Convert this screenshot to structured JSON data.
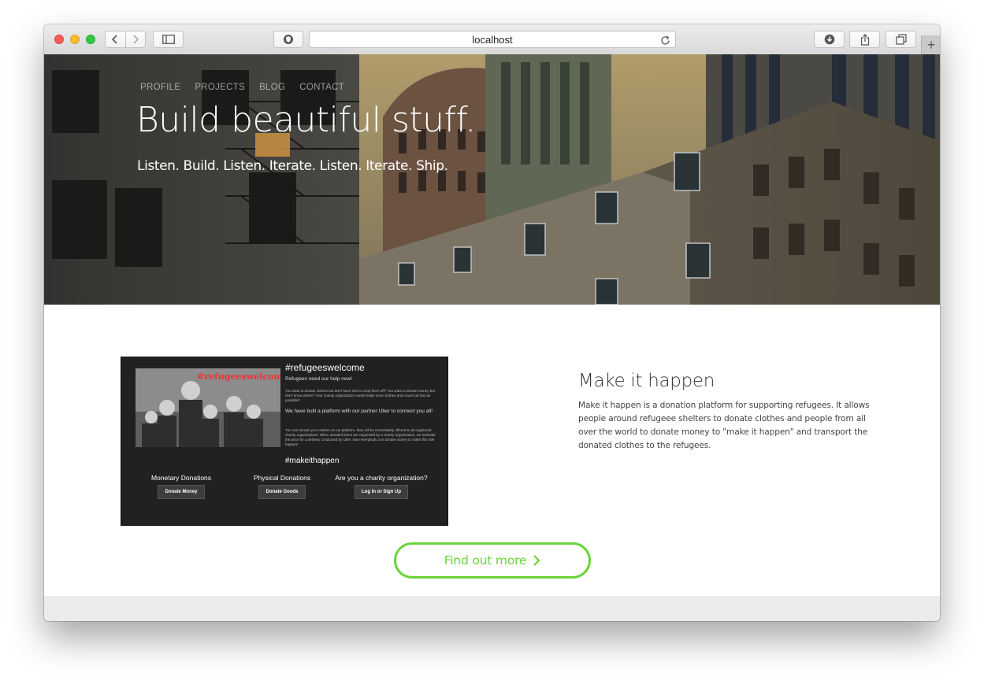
{
  "browser": {
    "url": "localhost",
    "new_tab": "+"
  },
  "nav": {
    "items": [
      "PROFILE",
      "PROJECTS",
      "BLOG",
      "CONTACT"
    ]
  },
  "hero": {
    "title": "Build beautiful stuff.",
    "subtitle": "Listen. Build. Listen. Iterate. Listen. Iterate. Ship."
  },
  "project": {
    "title": "Make it happen",
    "description": "Make it happen is a donation platform for supporting refugees. It allows people around refugeee shelters to donate clothes and people from all over the world to donate money to \"make it happen\" and transport the donated clothes to the refugees.",
    "cta_label": "Find out more"
  },
  "preview": {
    "photo_stamp": "#refugeeswelcome",
    "heading": "#refugeeswelcome",
    "tagline": "Refugees need our help now!",
    "para1": "You want to donate clothes but don't have time to drop them off? You want to donate money but don't know where? Your charity organization needs helps more clothes and covers as fast as possible?",
    "para2": "We have built a platform with our partner Uber to connect you all!",
    "para3": "You can donate your clothes on our platform, they will be immediately offered to all registered charity organizations. When donated items are requested by a charity organization, we estimate the price for a delivery conducted by Uber. Now everybody can donate money to make this ride happen!",
    "hashtag": "#makeithappen",
    "col1_label": "Monetary Donations",
    "col1_button": "Donate Money",
    "col2_label": "Physical Donations",
    "col2_button": "Donate Goods",
    "col3_label": "Are you a charity organization?",
    "col3_button": "Log In or Sign Up"
  },
  "colors": {
    "accent": "#6bd43a",
    "preview_bg": "#212121",
    "footer_bg": "#ececec"
  }
}
